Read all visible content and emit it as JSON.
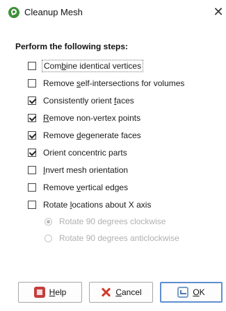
{
  "window": {
    "title": "Cleanup Mesh",
    "close_glyph": "✕"
  },
  "heading": "Perform the following steps:",
  "options": [
    {
      "pre": "Com",
      "key": "b",
      "post": "ine identical vertices",
      "checked": false,
      "focused": true
    },
    {
      "pre": "Remove ",
      "key": "s",
      "post": "elf-intersections for volumes",
      "checked": false
    },
    {
      "pre": "Consistently orient ",
      "key": "f",
      "post": "aces",
      "checked": true
    },
    {
      "pre": "",
      "key": "R",
      "post": "emove non-vertex points",
      "checked": true
    },
    {
      "pre": "Remove ",
      "key": "d",
      "post": "egenerate faces",
      "checked": true
    },
    {
      "pre": "Orient concentric parts",
      "key": "",
      "post": "",
      "checked": true
    },
    {
      "pre": "",
      "key": "I",
      "post": "nvert mesh orientation",
      "checked": false
    },
    {
      "pre": "Remove ",
      "key": "v",
      "post": "ertical edges",
      "checked": false
    },
    {
      "pre": "Rotate ",
      "key": "l",
      "post": "ocations about X axis",
      "checked": false
    }
  ],
  "rotation": [
    {
      "label": "Rotate 90 degrees clockwise",
      "selected": true
    },
    {
      "label": "Rotate 90 degrees anticlockwise",
      "selected": false
    }
  ],
  "buttons": {
    "help": {
      "key": "H",
      "rest": "elp",
      "icon": "help-book-icon"
    },
    "cancel": {
      "key": "C",
      "rest": "ancel",
      "icon": "cancel-x-icon"
    },
    "ok": {
      "key": "O",
      "rest": "K",
      "icon": "ok-return-icon"
    }
  },
  "colors": {
    "accent": "#5e8fd0",
    "app_icon": "#3f8f3a",
    "cancel_red": "#d23b2d"
  }
}
